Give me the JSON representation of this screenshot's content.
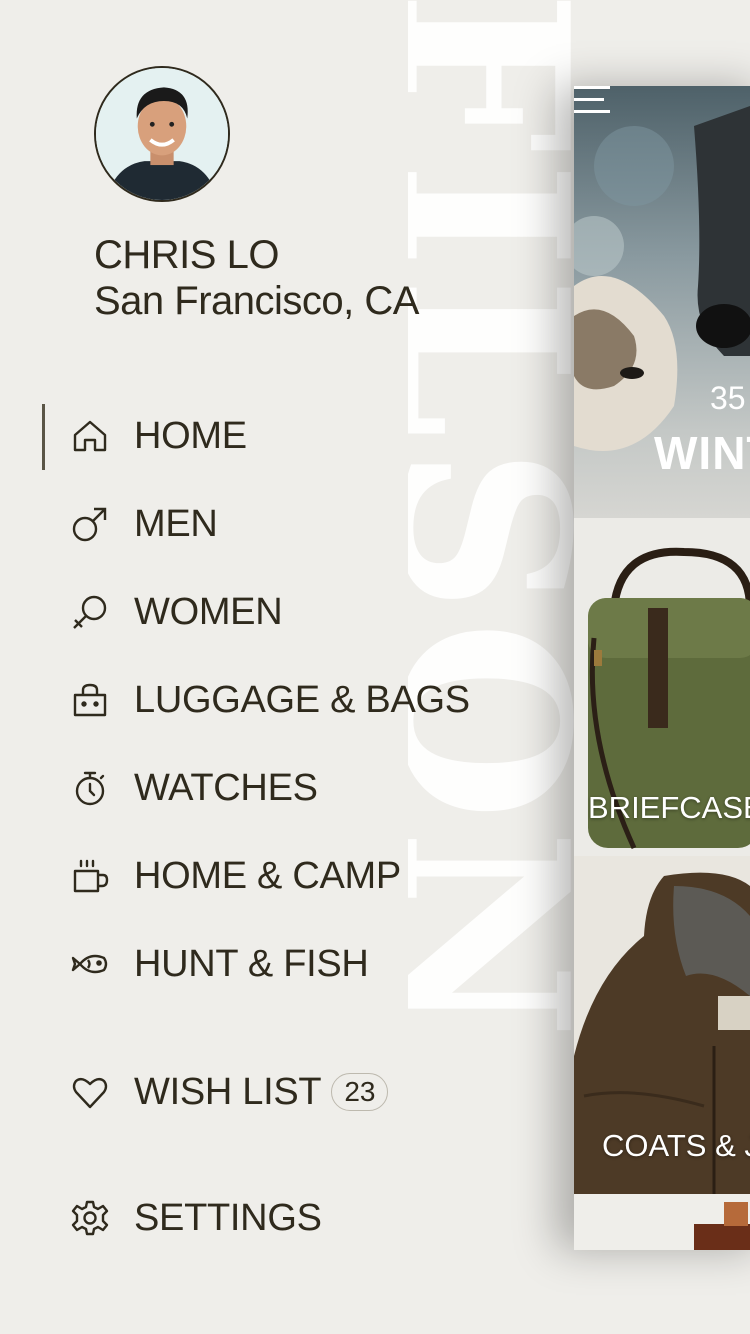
{
  "watermark": "FILSON",
  "user": {
    "name": "CHRIS LO",
    "location": "San Francisco, CA"
  },
  "nav": {
    "items": [
      {
        "label": "HOME",
        "icon": "home-icon",
        "active": true
      },
      {
        "label": "MEN",
        "icon": "male-icon"
      },
      {
        "label": "WOMEN",
        "icon": "female-icon"
      },
      {
        "label": "LUGGAGE & BAGS",
        "icon": "bag-icon"
      },
      {
        "label": "WATCHES",
        "icon": "stopwatch-icon"
      },
      {
        "label": "HOME & CAMP",
        "icon": "mug-icon"
      },
      {
        "label": "HUNT & FISH",
        "icon": "fish-icon"
      }
    ],
    "wishlist": {
      "label": "WISH LIST",
      "count": "23",
      "icon": "heart-icon"
    },
    "settings": {
      "label": "SETTINGS",
      "icon": "gear-icon"
    }
  },
  "panel": {
    "hero_count": "35",
    "hero_title": "WINT",
    "tiles": [
      "BRIEFCASE",
      "COATS & J"
    ]
  },
  "colors": {
    "background": "#efeeea",
    "text": "#2f2a1d",
    "panel": "#ffffff"
  }
}
